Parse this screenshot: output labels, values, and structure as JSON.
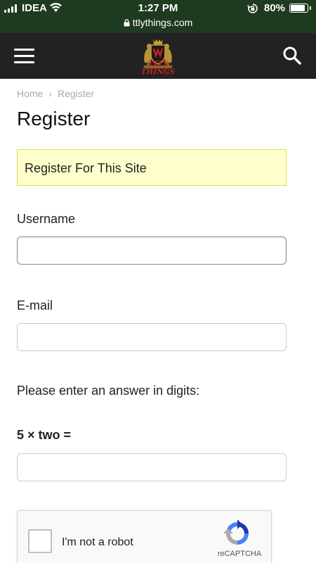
{
  "status_bar": {
    "carrier": "IDEA",
    "time": "1:27 PM",
    "battery_percent": "80%",
    "battery_level": 0.8,
    "url": "ttlythings.com",
    "bg_color": "#1e3a1f"
  },
  "header": {
    "logo_text": "TTLY THINGS",
    "bg_color": "#222222",
    "menu_icon": "hamburger-icon",
    "search_icon": "search-icon"
  },
  "breadcrumb": {
    "home": "Home",
    "separator": "›",
    "current": "Register"
  },
  "page_title": "Register",
  "notice": "Register For This Site",
  "form": {
    "username_label": "Username",
    "username_value": "",
    "email_label": "E-mail",
    "email_value": "",
    "captcha_instruction": "Please enter an answer in digits:",
    "captcha_question": "5 × two =",
    "captcha_value": ""
  },
  "recaptcha": {
    "label": "I'm not a robot",
    "brand": "reCAPTCHA",
    "checked": false
  }
}
